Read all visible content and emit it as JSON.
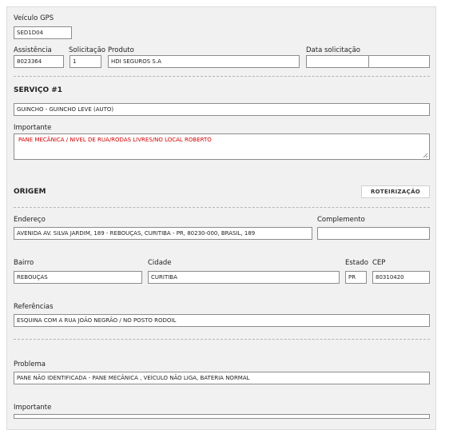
{
  "veiculo": {
    "label": "Veículo GPS",
    "value": "SED1D04"
  },
  "assistencia": {
    "label": "Assistência",
    "value": "8023364"
  },
  "solicitacao": {
    "label": "Solicitação",
    "value": "1"
  },
  "produto": {
    "label": "Produto",
    "value": "HDI SEGUROS S.A"
  },
  "data_solicitacao": {
    "label": "Data solicitação",
    "value_1": "",
    "value_2": ""
  },
  "servico": {
    "title": "SERVIÇO #1",
    "value": "GUINCHO - GUINCHO LEVE (AUTO)",
    "importante_label": "Importante",
    "importante_value": "PANE MECÂNICA / NIVEL DE RUA/RODAS LIVRES/NO LOCAL ROBERTO"
  },
  "origem": {
    "title": "ORIGEM",
    "button": "ROTEIRIZAÇÃO",
    "endereco_label": "Endereço",
    "endereco_value": "AVENIDA AV. SILVA JARDIM, 189 - REBOUÇAS, CURITIBA - PR, 80230-000, BRASIL, 189",
    "complemento_label": "Complemento",
    "complemento_value": "",
    "bairro_label": "Bairro",
    "bairro_value": "REBOUÇAS",
    "cidade_label": "Cidade",
    "cidade_value": "CURITIBA",
    "estado_label": "Estado",
    "estado_value": "PR",
    "cep_label": "CEP",
    "cep_value": "80310420",
    "referencias_label": "Referências",
    "referencias_value": "ESQUINA COM A RUA  JOÃO NEGRÃO / NO POSTO RODOIL"
  },
  "problema": {
    "label": "Problema",
    "value": "PANE NÃO IDENTIFICADA -  PANE MECÂNICA , VEÍCULO NÃO LIGA, BATERIA NORMAL",
    "importante_label": "Importante"
  }
}
